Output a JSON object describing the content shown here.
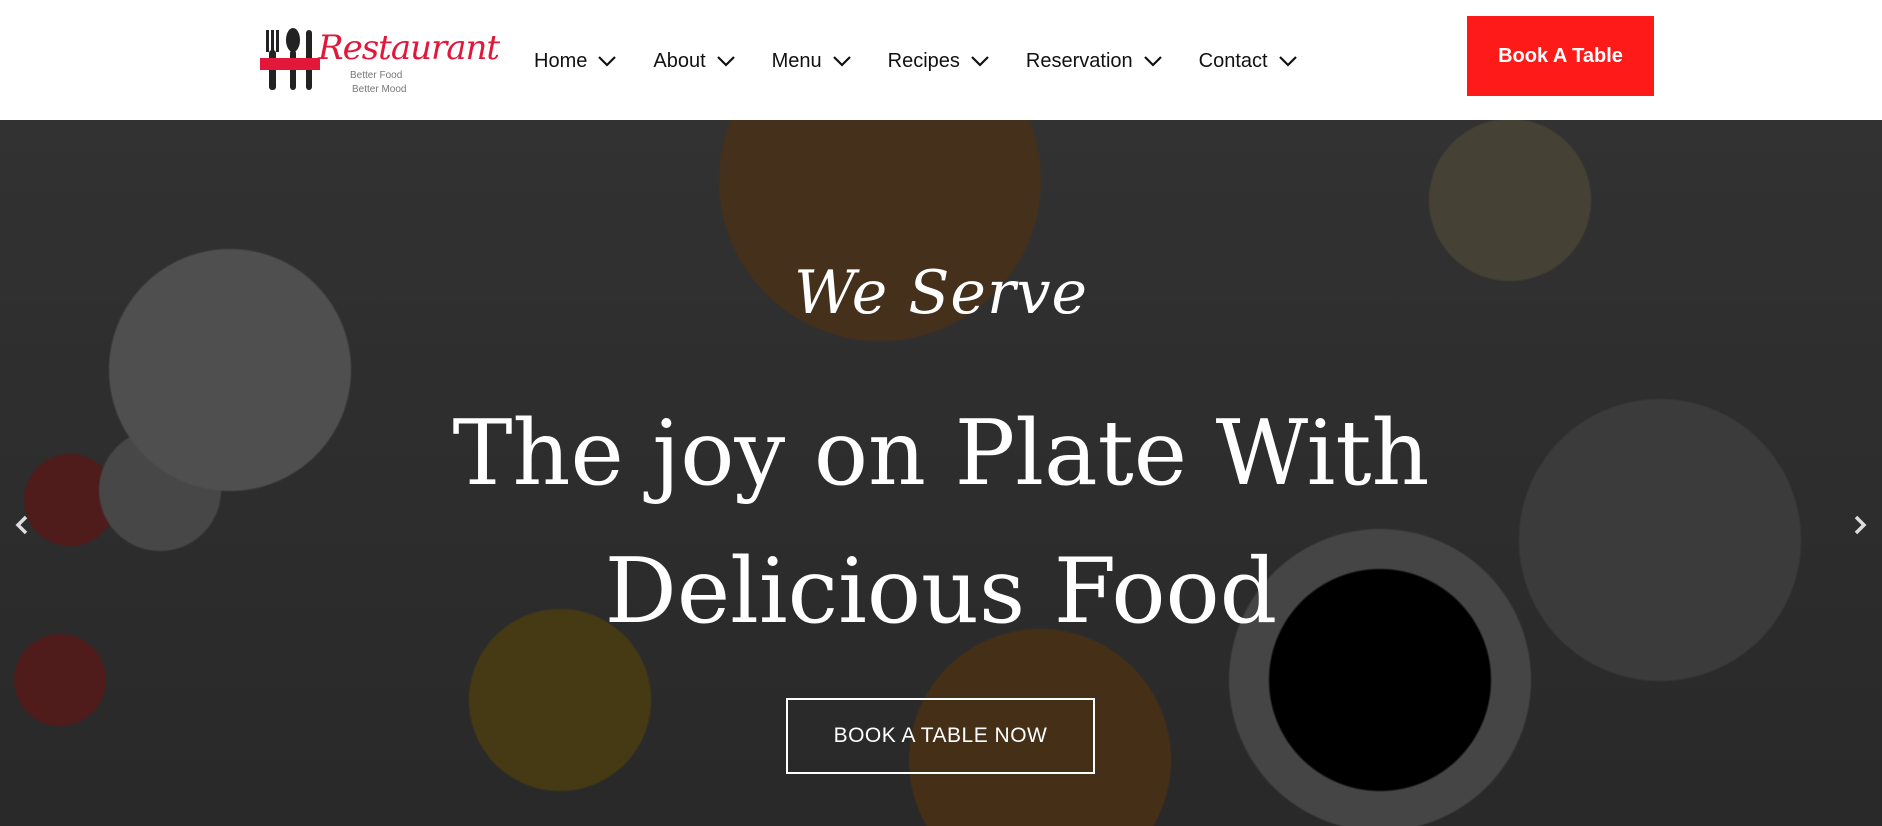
{
  "brand": {
    "logo_script": "Restaurant",
    "tagline_line1": "Better Food",
    "tagline_line2": "Better Mood",
    "accent_color": "#e3173a"
  },
  "nav": {
    "items": [
      {
        "label": "Home",
        "icon": "chevron-down-icon"
      },
      {
        "label": "About",
        "icon": "chevron-down-icon"
      },
      {
        "label": "Menu",
        "icon": "chevron-down-icon"
      },
      {
        "label": "Recipes",
        "icon": "chevron-down-icon"
      },
      {
        "label": "Reservation",
        "icon": "chevron-down-icon"
      },
      {
        "label": "Contact",
        "icon": "chevron-down-icon"
      }
    ],
    "cta_label": "Book A Table",
    "cta_color": "#ff1a1a"
  },
  "hero": {
    "eyebrow": "We Serve",
    "title_line1": "The joy on Plate With",
    "title_line2": "Delicious Food",
    "button_label": "BOOK A TABLE NOW",
    "prev_icon": "chevron-left-icon",
    "next_icon": "chevron-right-icon"
  }
}
